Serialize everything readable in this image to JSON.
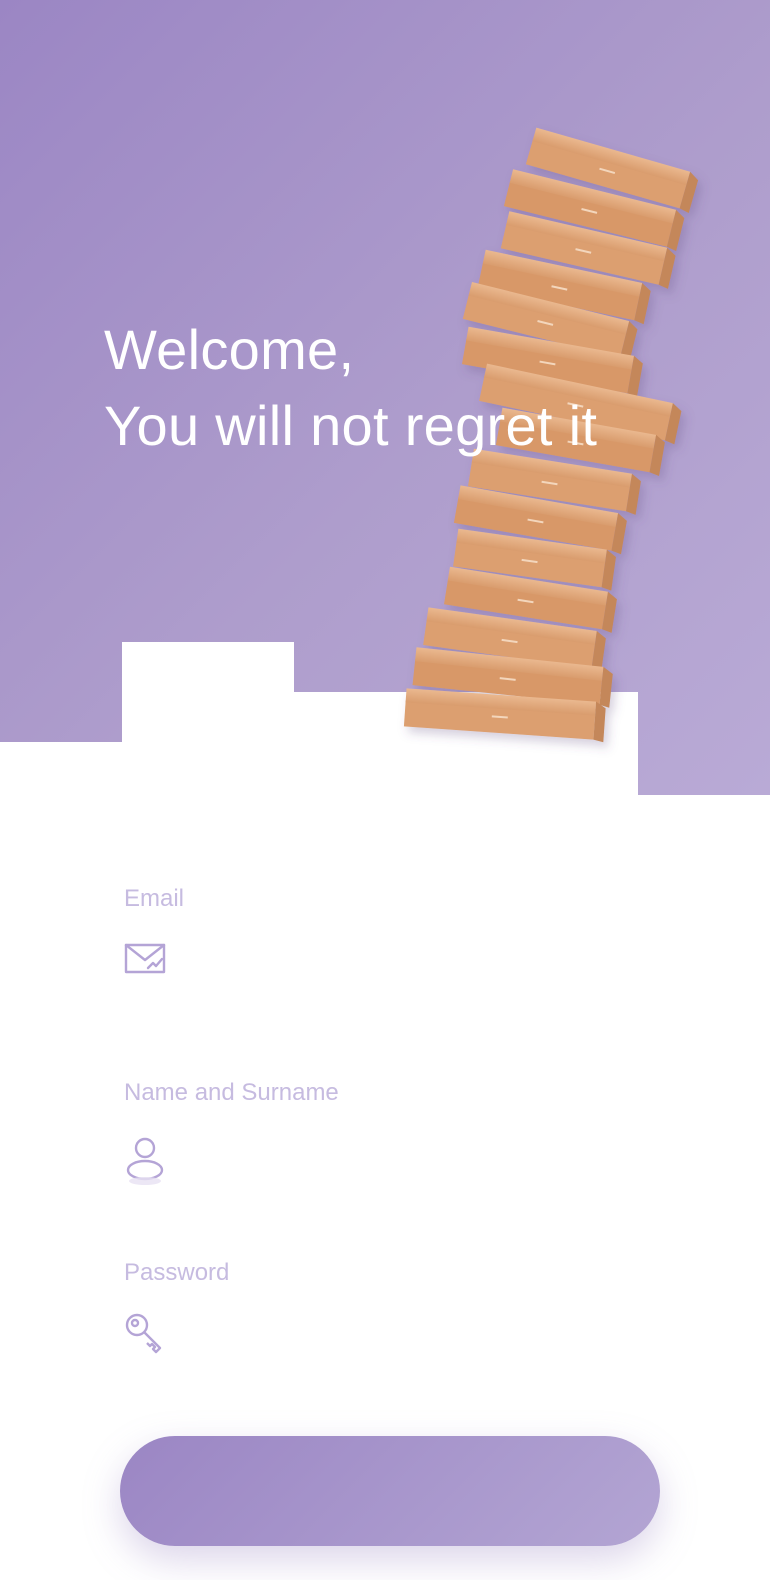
{
  "hero": {
    "line1": "Welcome,",
    "line2": "You will not regret it",
    "illustration": "stacked-cardboard-boxes"
  },
  "form": {
    "email": {
      "label": "Email",
      "icon": "mail-icon",
      "value": "",
      "placeholder": ""
    },
    "name": {
      "label": "Name and Surname",
      "icon": "user-icon",
      "value": "",
      "placeholder": ""
    },
    "password": {
      "label": "Password",
      "icon": "key-icon",
      "value": "",
      "placeholder": ""
    },
    "submit_label": ""
  },
  "colors": {
    "accent": "#9b86c4",
    "accent_light": "#b9aad6",
    "label": "#c6bbe0",
    "box": "#e3aa7d"
  }
}
